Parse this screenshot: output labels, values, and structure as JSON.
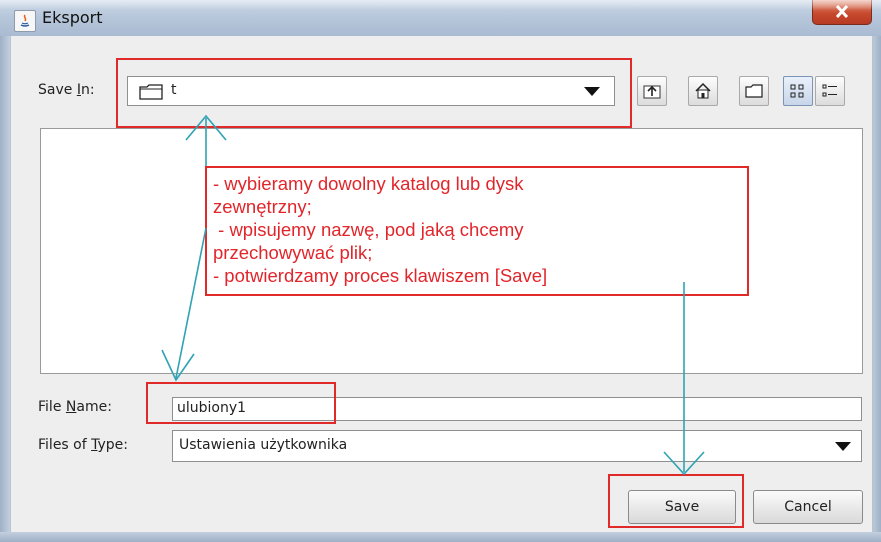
{
  "window": {
    "title": "Eksport"
  },
  "save_in": {
    "label_prefix": "Save ",
    "label_mnemonic": "I",
    "label_suffix": "n:",
    "value": "t"
  },
  "toolbar": {
    "icons": [
      "up-one-level-icon",
      "home-icon",
      "new-folder-icon",
      "list-view-icon",
      "details-view-icon"
    ]
  },
  "annotation": {
    "lines": [
      "- wybieramy dowolny katalog lub dysk",
      "zewnętrzny;",
      " - wpisujemy nazwę, pod jaką chcemy",
      "przechowywać plik;",
      "- potwierdzamy proces klawiszem [Save]"
    ],
    "color": "#e1262b"
  },
  "file_name": {
    "label_prefix": "File ",
    "label_mnemonic": "N",
    "label_suffix": "ame:",
    "value": "ulubiony1"
  },
  "files_of_type": {
    "label_prefix": "Files of ",
    "label_mnemonic": "T",
    "label_suffix": "ype:",
    "value": "Ustawienia użytkownika"
  },
  "buttons": {
    "save": "Save",
    "cancel": "Cancel"
  },
  "colors": {
    "highlight_box": "#e02a2a",
    "arrow": "#2fa3b3"
  }
}
